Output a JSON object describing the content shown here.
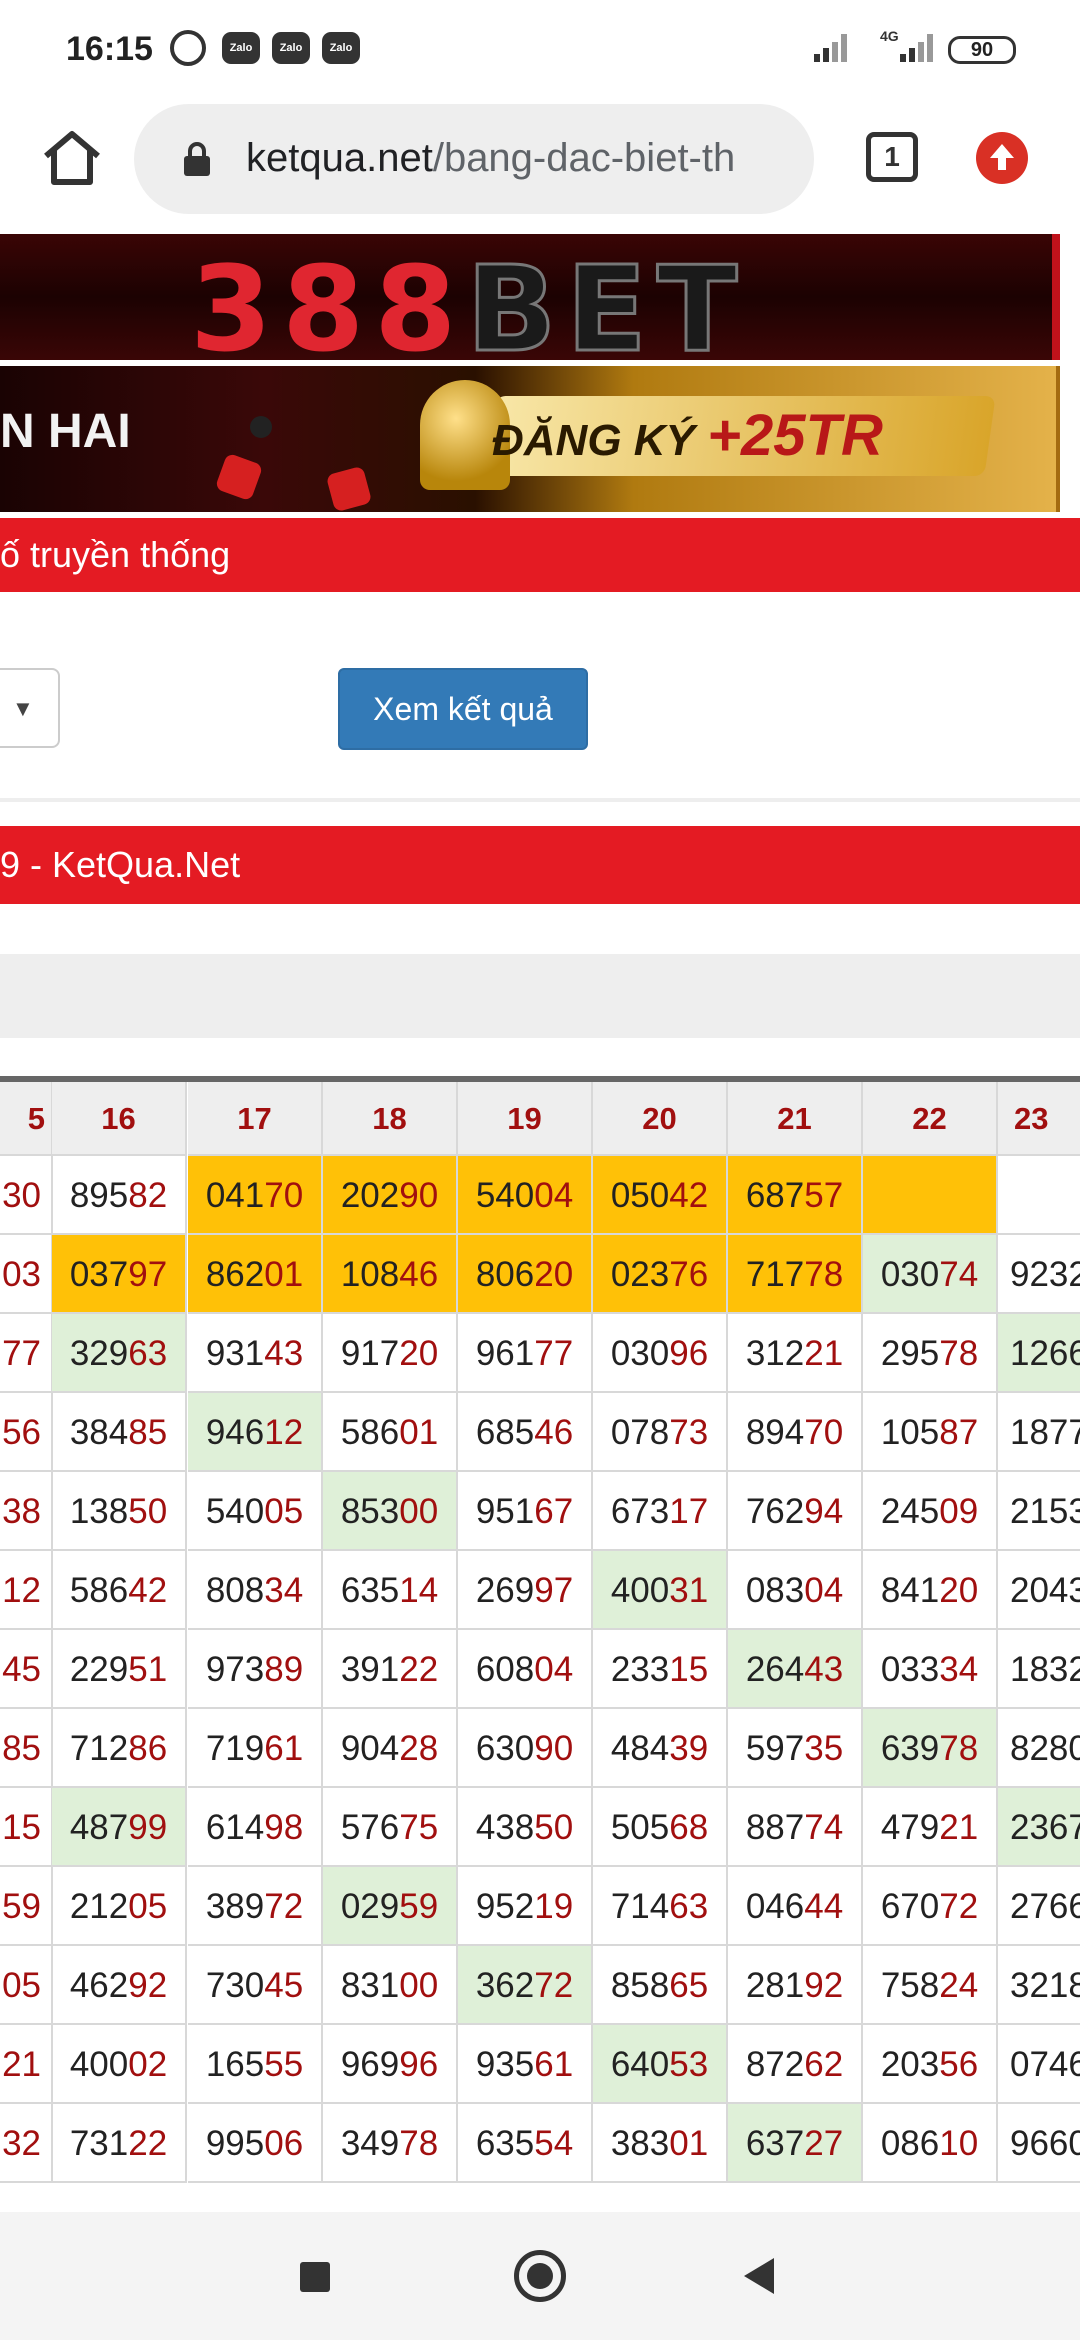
{
  "status_bar": {
    "time": "16:15",
    "notifications": [
      "Zalo",
      "Zalo",
      "Zalo"
    ],
    "network": "4G",
    "battery": "90"
  },
  "browser": {
    "url_domain": "ketqua.net",
    "url_path": "/bang-dac-biet-th",
    "tab_count": "1"
  },
  "banners": {
    "brand_red": "388",
    "brand_dark": "BET",
    "promo_left": "N HAI",
    "promo_cta": "ĐĂNG KÝ",
    "promo_bonus": "+25TR"
  },
  "section_title": "ố truyền thống",
  "view_button": "Xem kết quả",
  "result_title": "9 - KetQua.Net",
  "colors": {
    "red_bar": "#e41b23",
    "button_blue": "#337ab7",
    "highlight_orange": "#ffc107",
    "highlight_green": "#dff0d8",
    "digit_red": "#a10f0f"
  },
  "table": {
    "columns": [
      "5",
      "16",
      "17",
      "18",
      "19",
      "20",
      "21",
      "22",
      "23"
    ],
    "rows": [
      [
        {
          "v": "30",
          "h": ""
        },
        {
          "v": "89582",
          "h": ""
        },
        {
          "v": "04170",
          "h": "orange"
        },
        {
          "v": "20290",
          "h": "orange"
        },
        {
          "v": "54004",
          "h": "orange"
        },
        {
          "v": "05042",
          "h": "orange"
        },
        {
          "v": "68757",
          "h": "orange"
        },
        {
          "v": "",
          "h": "orange"
        },
        {
          "v": "",
          "h": ""
        }
      ],
      [
        {
          "v": "03",
          "h": ""
        },
        {
          "v": "03797",
          "h": "orange"
        },
        {
          "v": "86201",
          "h": "orange"
        },
        {
          "v": "10846",
          "h": "orange"
        },
        {
          "v": "80620",
          "h": "orange"
        },
        {
          "v": "02376",
          "h": "orange"
        },
        {
          "v": "71778",
          "h": "orange"
        },
        {
          "v": "03074",
          "h": "green"
        },
        {
          "v": "9232",
          "h": ""
        }
      ],
      [
        {
          "v": "77",
          "h": ""
        },
        {
          "v": "32963",
          "h": "green"
        },
        {
          "v": "93143",
          "h": ""
        },
        {
          "v": "91720",
          "h": ""
        },
        {
          "v": "96177",
          "h": ""
        },
        {
          "v": "03096",
          "h": ""
        },
        {
          "v": "31221",
          "h": ""
        },
        {
          "v": "29578",
          "h": ""
        },
        {
          "v": "1266",
          "h": "green"
        }
      ],
      [
        {
          "v": "56",
          "h": ""
        },
        {
          "v": "38485",
          "h": ""
        },
        {
          "v": "94612",
          "h": "green"
        },
        {
          "v": "58601",
          "h": ""
        },
        {
          "v": "68546",
          "h": ""
        },
        {
          "v": "07873",
          "h": ""
        },
        {
          "v": "89470",
          "h": ""
        },
        {
          "v": "10587",
          "h": ""
        },
        {
          "v": "1877",
          "h": ""
        }
      ],
      [
        {
          "v": "38",
          "h": ""
        },
        {
          "v": "13850",
          "h": ""
        },
        {
          "v": "54005",
          "h": ""
        },
        {
          "v": "85300",
          "h": "green"
        },
        {
          "v": "95167",
          "h": ""
        },
        {
          "v": "67317",
          "h": ""
        },
        {
          "v": "76294",
          "h": ""
        },
        {
          "v": "24509",
          "h": ""
        },
        {
          "v": "2153",
          "h": ""
        }
      ],
      [
        {
          "v": "12",
          "h": ""
        },
        {
          "v": "58642",
          "h": ""
        },
        {
          "v": "80834",
          "h": ""
        },
        {
          "v": "63514",
          "h": ""
        },
        {
          "v": "26997",
          "h": ""
        },
        {
          "v": "40031",
          "h": "green"
        },
        {
          "v": "08304",
          "h": ""
        },
        {
          "v": "84120",
          "h": ""
        },
        {
          "v": "2043",
          "h": ""
        }
      ],
      [
        {
          "v": "45",
          "h": ""
        },
        {
          "v": "22951",
          "h": ""
        },
        {
          "v": "97389",
          "h": ""
        },
        {
          "v": "39122",
          "h": ""
        },
        {
          "v": "60804",
          "h": ""
        },
        {
          "v": "23315",
          "h": ""
        },
        {
          "v": "26443",
          "h": "green"
        },
        {
          "v": "03334",
          "h": ""
        },
        {
          "v": "1832",
          "h": ""
        }
      ],
      [
        {
          "v": "85",
          "h": ""
        },
        {
          "v": "71286",
          "h": ""
        },
        {
          "v": "71961",
          "h": ""
        },
        {
          "v": "90428",
          "h": ""
        },
        {
          "v": "63090",
          "h": ""
        },
        {
          "v": "48439",
          "h": ""
        },
        {
          "v": "59735",
          "h": ""
        },
        {
          "v": "63978",
          "h": "green"
        },
        {
          "v": "8280",
          "h": ""
        }
      ],
      [
        {
          "v": "15",
          "h": ""
        },
        {
          "v": "48799",
          "h": "green"
        },
        {
          "v": "61498",
          "h": ""
        },
        {
          "v": "57675",
          "h": ""
        },
        {
          "v": "43850",
          "h": ""
        },
        {
          "v": "50568",
          "h": ""
        },
        {
          "v": "88774",
          "h": ""
        },
        {
          "v": "47921",
          "h": ""
        },
        {
          "v": "2367",
          "h": "green"
        }
      ],
      [
        {
          "v": "59",
          "h": ""
        },
        {
          "v": "21205",
          "h": ""
        },
        {
          "v": "38972",
          "h": ""
        },
        {
          "v": "02959",
          "h": "green"
        },
        {
          "v": "95219",
          "h": ""
        },
        {
          "v": "71463",
          "h": ""
        },
        {
          "v": "04644",
          "h": ""
        },
        {
          "v": "67072",
          "h": ""
        },
        {
          "v": "2766",
          "h": ""
        }
      ],
      [
        {
          "v": "05",
          "h": ""
        },
        {
          "v": "46292",
          "h": ""
        },
        {
          "v": "73045",
          "h": ""
        },
        {
          "v": "83100",
          "h": ""
        },
        {
          "v": "36272",
          "h": "green"
        },
        {
          "v": "85865",
          "h": ""
        },
        {
          "v": "28192",
          "h": ""
        },
        {
          "v": "75824",
          "h": ""
        },
        {
          "v": "3218",
          "h": ""
        }
      ],
      [
        {
          "v": "21",
          "h": ""
        },
        {
          "v": "40002",
          "h": ""
        },
        {
          "v": "16555",
          "h": ""
        },
        {
          "v": "96996",
          "h": ""
        },
        {
          "v": "93561",
          "h": ""
        },
        {
          "v": "64053",
          "h": "green"
        },
        {
          "v": "87262",
          "h": ""
        },
        {
          "v": "20356",
          "h": ""
        },
        {
          "v": "0746",
          "h": ""
        }
      ],
      [
        {
          "v": "32",
          "h": ""
        },
        {
          "v": "73122",
          "h": ""
        },
        {
          "v": "99506",
          "h": ""
        },
        {
          "v": "34978",
          "h": ""
        },
        {
          "v": "63554",
          "h": ""
        },
        {
          "v": "38301",
          "h": ""
        },
        {
          "v": "63727",
          "h": "green"
        },
        {
          "v": "08610",
          "h": ""
        },
        {
          "v": "9660",
          "h": ""
        }
      ]
    ]
  }
}
